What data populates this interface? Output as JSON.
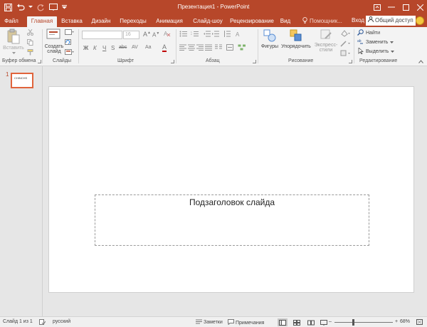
{
  "window": {
    "title": "Презентация1 - PowerPoint",
    "brand_color": "#b7472a"
  },
  "tabs": [
    {
      "label": "Файл"
    },
    {
      "label": "Главная",
      "active": true
    },
    {
      "label": "Вставка"
    },
    {
      "label": "Дизайн"
    },
    {
      "label": "Переходы"
    },
    {
      "label": "Анимация"
    },
    {
      "label": "Слайд-шоу"
    },
    {
      "label": "Рецензирование"
    },
    {
      "label": "Вид"
    }
  ],
  "header": {
    "tell_me": "Помощник...",
    "sign_in": "Вход",
    "share": "Общий доступ"
  },
  "ribbon": {
    "clipboard": {
      "paste": "Вставить",
      "group": "Буфер обмена"
    },
    "slides": {
      "new_slide_line1": "Создать",
      "new_slide_line2": "слайд",
      "group": "Слайды"
    },
    "font": {
      "size": "16",
      "group": "Шрифт",
      "bold": "Ж",
      "italic": "К",
      "underline": "Ч",
      "strike": "S",
      "shadow": "abc",
      "spacing": "AV",
      "case": "Aa",
      "color": "A"
    },
    "paragraph": {
      "group": "Абзац"
    },
    "drawing": {
      "shapes": "Фигуры",
      "arrange": "Упорядочить",
      "quick_styles_line1": "Экспресс-",
      "quick_styles_line2": "стили",
      "group": "Рисование"
    },
    "editing": {
      "find": "Найти",
      "replace": "Заменить",
      "select": "Выделить",
      "group": "Редактирование"
    }
  },
  "thumbnails": [
    {
      "number": "1",
      "text": "CHINCHS"
    }
  ],
  "slide": {
    "subtitle_placeholder": "Подзаголовок слайда"
  },
  "status": {
    "slide_info": "Слайд 1 из 1",
    "language": "русский",
    "notes": "Заметки",
    "comments": "Примечания",
    "zoom": "68%",
    "zoom_value": 68
  }
}
